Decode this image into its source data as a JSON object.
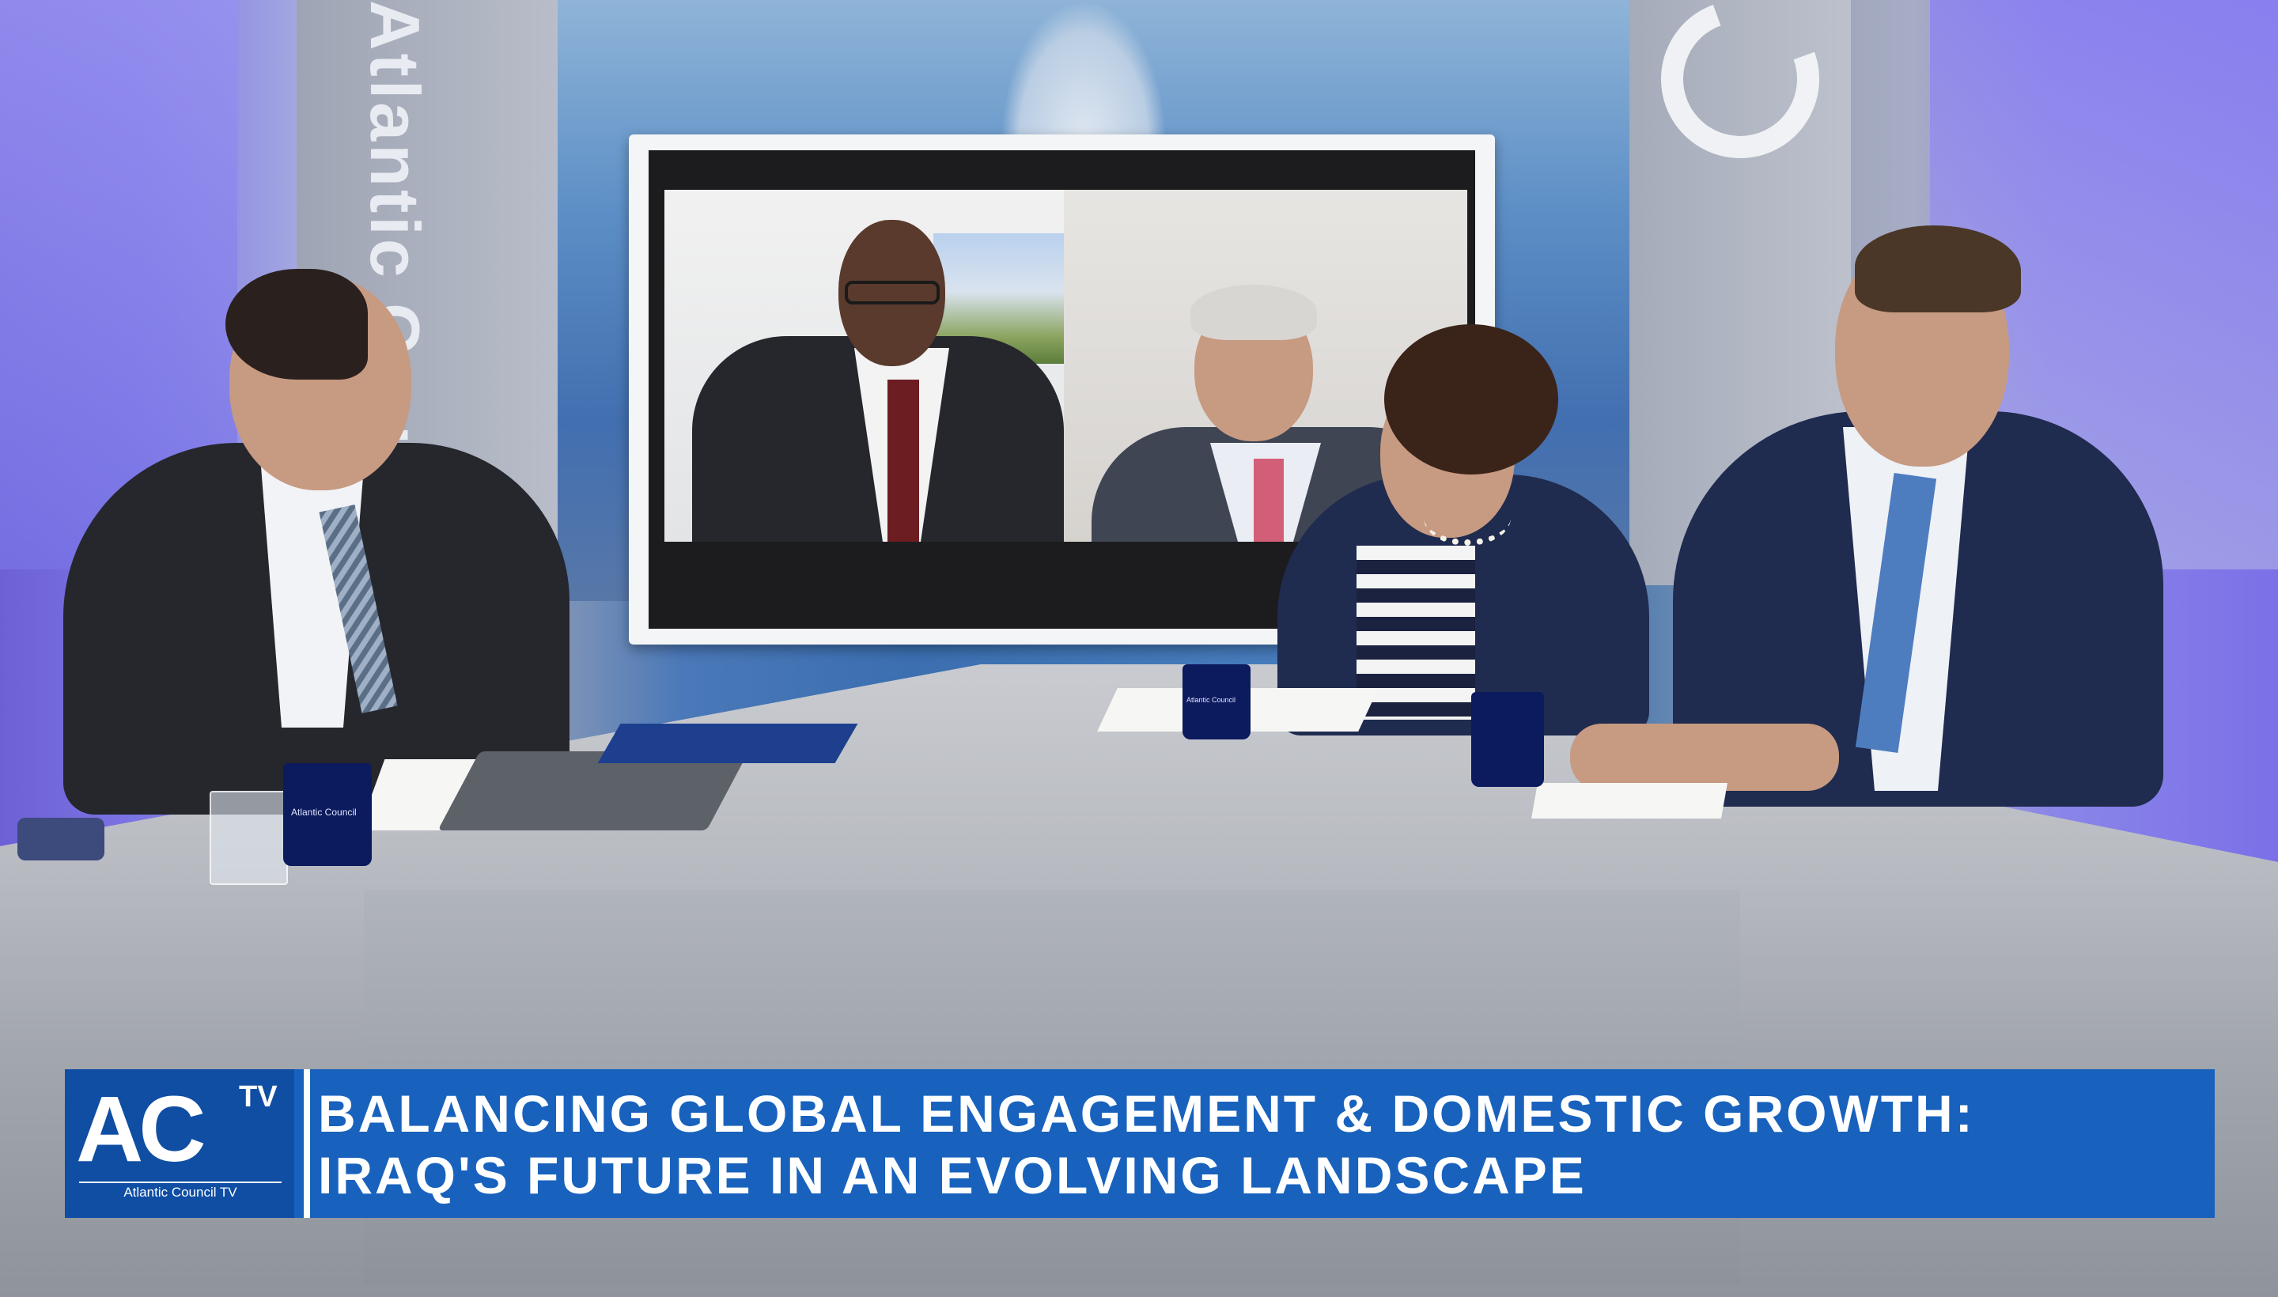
{
  "studio": {
    "brand_text": "Atlantic Council",
    "mug_label": "Atlantic Council"
  },
  "lower_third": {
    "logo_main": "AC",
    "logo_tv": "TV",
    "logo_sub": "Atlantic Council TV",
    "headline_line1": "BALANCING GLOBAL ENGAGEMENT & DOMESTIC GROWTH:",
    "headline_line2": "IRAQ'S FUTURE IN AN EVOLVING LANDSCAPE"
  },
  "colors": {
    "banner_blue": "#1862bd",
    "logo_box_blue": "#0f4ea3",
    "mug_navy": "#0c1a5e"
  }
}
